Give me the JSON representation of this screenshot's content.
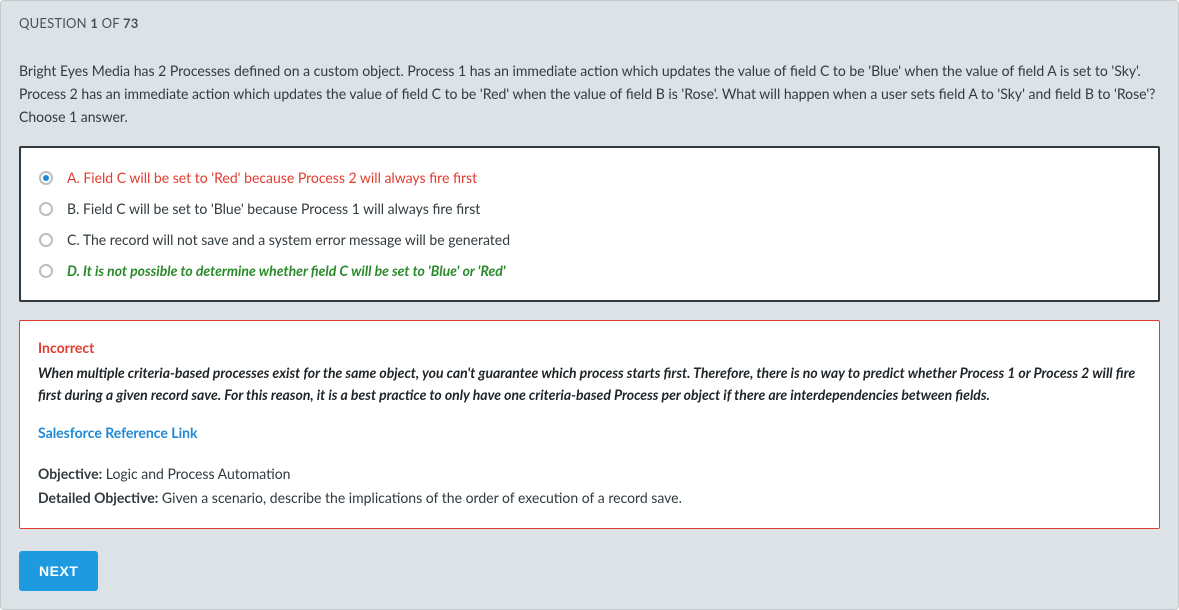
{
  "header": {
    "prefix": "QUESTION ",
    "current": "1",
    "of_word": " OF ",
    "total": "73"
  },
  "question_text": "Bright Eyes Media has 2 Processes defined on a custom object. Process 1 has an immediate action which updates the value of field C to be 'Blue' when the value of field A is set to 'Sky'. Process 2 has an immediate action which updates the value of field C to be 'Red' when the value of field B is 'Rose'. What will happen when a user sets field A to 'Sky' and field B to 'Rose'? Choose 1 answer.",
  "answers": {
    "a": "A. Field C will be set to 'Red' because Process 2 will always fire first",
    "b": "B. Field C will be set to 'Blue' because Process 1 will always fire first",
    "c": "C. The record will not save and a system error message will be generated",
    "d": "D. It is not possible to determine whether field C will be set to 'Blue' or 'Red'"
  },
  "feedback": {
    "verdict": "Incorrect",
    "explanation": "When multiple criteria-based processes exist for the same object, you can't guarantee which process starts first. Therefore, there is no way to predict whether Process 1 or Process 2 will fire first during a given record save. For this reason, it is a best practice to only have one criteria-based Process per object if there are interdependencies between fields.",
    "reference_link_text": "Salesforce Reference Link",
    "objective_label": "Objective:",
    "objective_value": " Logic and Process Automation",
    "detailed_label": "Detailed Objective:",
    "detailed_value": " Given a scenario, describe the implications of the order of execution of a record save."
  },
  "buttons": {
    "next": "NEXT"
  }
}
